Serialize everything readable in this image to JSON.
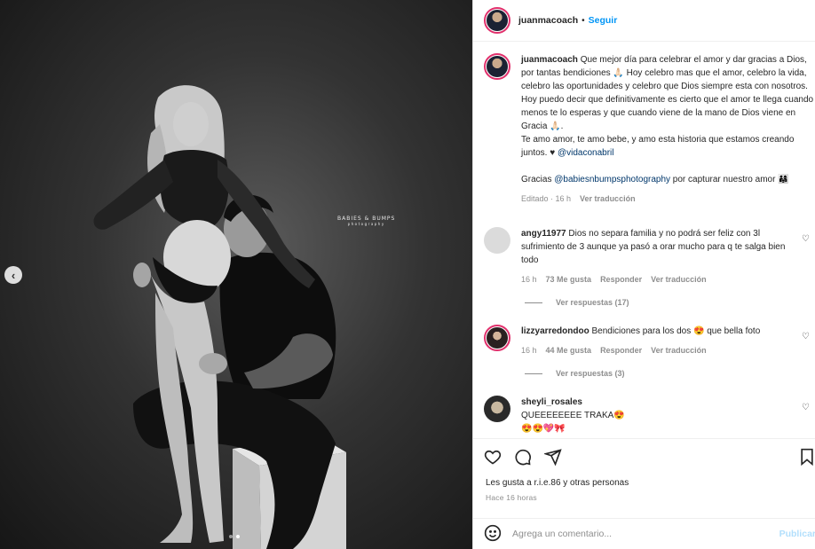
{
  "photo": {
    "watermark_line1": "BABIES & BUMPS",
    "watermark_line2": "photography",
    "prev_icon": "chevron-left-icon",
    "slide_count": 2,
    "active_slide": 2
  },
  "header": {
    "username": "juanmacoach",
    "separator": "•",
    "follow_label": "Seguir"
  },
  "caption": {
    "username": "juanmacoach",
    "text1": "Que mejor día para celebrar el amor y dar gracias a Dios, por tantas bendiciones 🙏🏻 Hoy celebro mas que el amor, celebro la vida, celebro las oportunidades y celebro que Dios siempre esta con nosotros. Hoy puedo decir que definitivamente es cierto que el amor te llega cuando menos te lo esperas y que cuando viene de la mano de Dios viene en Gracia 🙏🏻.",
    "text2": "Te amo amor, te amo bebe, y amo esta historia que estamos creando juntos. ♥ ",
    "mention1": "@vidaconabril",
    "text3": "Gracias ",
    "mention2": "@babiesnbumpsphotography",
    "text4": " por capturar nuestro amor 👨‍👩‍👧",
    "meta_edited": "Editado · 16 h",
    "meta_translate": "Ver traducción"
  },
  "comments": [
    {
      "username": "angy11977",
      "text": "Dios no separa familia y no podrá ser feliz con 3l sufrimiento de 3 aunque ya pasó a orar mucho para q te salga bien todo",
      "time": "16 h",
      "likes": "73 Me gusta",
      "reply": "Responder",
      "translate": "Ver traducción",
      "replies": "Ver respuestas (17)"
    },
    {
      "username": "lizzyarredondoo",
      "text": "Bendiciones para los dos 😍 que bella foto",
      "time": "16 h",
      "likes": "44 Me gusta",
      "reply": "Responder",
      "translate": "Ver traducción",
      "replies": "Ver respuestas (3)"
    },
    {
      "username": "sheyli_rosales",
      "text": "QUEEEEEEEE TRAKA😍😍😍💖🎀"
    }
  ],
  "actions": {
    "likes_text": "Les gusta a r.i.e.86 y otras personas",
    "time_text": "Hace 16 horas"
  },
  "add_comment": {
    "placeholder": "Agrega un comentario...",
    "post_label": "Publicar"
  },
  "colors": {
    "link_blue": "#0095f6",
    "mention_blue": "#00376b",
    "muted": "#8e8e8e"
  }
}
